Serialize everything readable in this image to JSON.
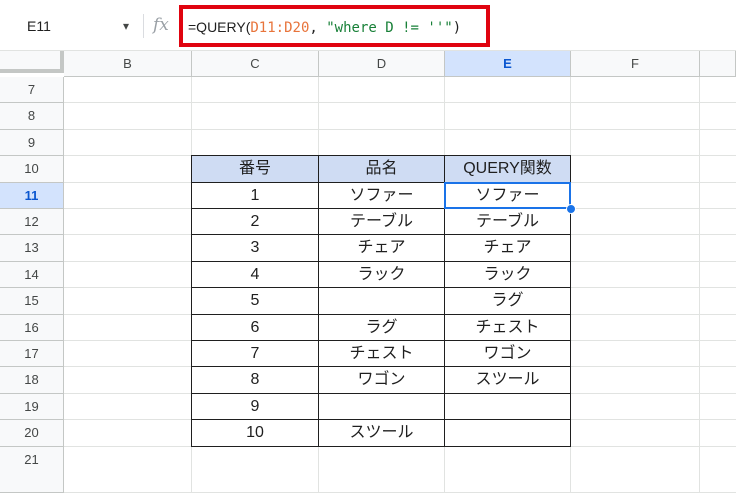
{
  "formula_bar": {
    "name_box": "E11",
    "chevron_icon": "▾",
    "fx_icon": "fx",
    "formula": {
      "prefix": "=QUERY(",
      "range": "D11:D20",
      "sep": ", ",
      "string": "\"where D != ''\"",
      "suffix": ")"
    }
  },
  "colors": {
    "highlight_border": "#e0030f",
    "table_header_fill": "#cfdcf3",
    "active_cell": "#1a73e8",
    "range_token": "#e8743b",
    "string_token": "#188038"
  },
  "columns": [
    "B",
    "C",
    "D",
    "E",
    "F"
  ],
  "selected_column": "E",
  "rows": [
    "7",
    "8",
    "9",
    "10",
    "11",
    "12",
    "13",
    "14",
    "15",
    "16",
    "17",
    "18",
    "19",
    "20",
    "21"
  ],
  "selected_row": "11",
  "table": {
    "headers": [
      "番号",
      "品名",
      "QUERY関数"
    ],
    "body": [
      [
        "1",
        "ソファー",
        "ソファー"
      ],
      [
        "2",
        "テーブル",
        "テーブル"
      ],
      [
        "3",
        "チェア",
        "チェア"
      ],
      [
        "4",
        "ラック",
        "ラック"
      ],
      [
        "5",
        "",
        "ラグ"
      ],
      [
        "6",
        "ラグ",
        "チェスト"
      ],
      [
        "7",
        "チェスト",
        "ワゴン"
      ],
      [
        "8",
        "ワゴン",
        "スツール"
      ],
      [
        "9",
        "",
        ""
      ],
      [
        "10",
        "スツール",
        ""
      ]
    ]
  }
}
